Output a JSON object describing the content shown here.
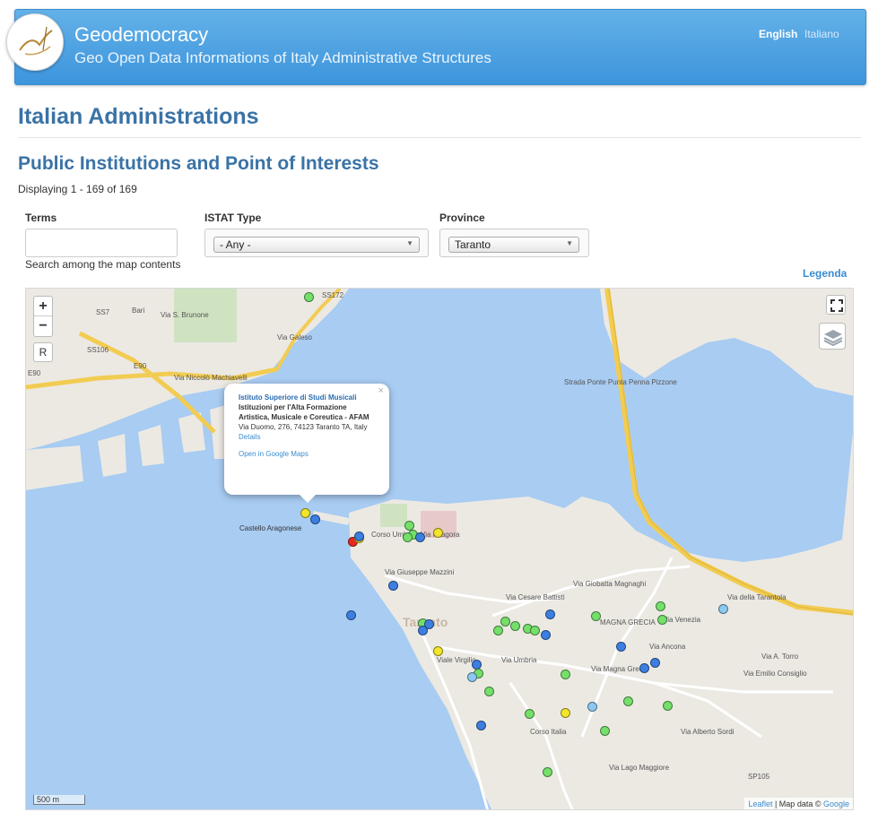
{
  "header": {
    "site_name": "Geodemocracy",
    "slogan": "Geo Open Data Informations of Italy Administrative Structures",
    "languages": [
      "English",
      "Italiano"
    ]
  },
  "page": {
    "title": "Italian Administrations",
    "view_title": "Public Institutions and Point of Interests",
    "summary": "Displaying 1 - 169 of 169"
  },
  "filters": {
    "terms_label": "Terms",
    "terms_value": "",
    "terms_help": "Search among the map contents",
    "type_label": "ISTAT Type",
    "type_value": "- Any -",
    "province_label": "Province",
    "province_value": "Taranto"
  },
  "legenda": "Legenda",
  "map": {
    "zoom_in": "+",
    "zoom_out": "−",
    "reset": "R",
    "scale": "500 m",
    "attribution_leaflet": "Leaflet",
    "attribution_text": " | Map data © ",
    "attribution_google": "Google",
    "city_label": "Taranto",
    "castle_label": "Castello Aragonese",
    "popup": {
      "title": "Istituto Superiore di Studi Musicali",
      "category": "Istituzioni per l'Alta Formazione Artistica, Musicale e Coreutica - AFAM",
      "address": "Via Duomo, 276, 74123 Taranto TA, Italy",
      "details": "Details",
      "google_maps": "Open in Google Maps",
      "close": "×"
    },
    "streets": {
      "via_giuseppe_mazzini": "Via Giuseppe Mazzini",
      "via_cesare_battisti": "Via Cesare Battisti",
      "via_giobatta_magnaghi": "Via Giobatta Magnaghi",
      "via_della_tarantola": "Via della Tarantola",
      "via_umbria": "Via Umbria",
      "viale_virgilio": "Viale Virgilio",
      "corso_italia": "Corso Italia",
      "via_magna_grecia": "Via Magna Grecia",
      "via_alberto_sordi": "Via Alberto Sordi",
      "via_emilio_consiglio": "Via Emilio Consiglio",
      "via_a_torro": "Via A. Torro",
      "via_venezia": "Via Venezia",
      "via_ancona": "Via Ancona",
      "via_lago_maggiore": "Via Lago Maggiore",
      "via_galeso": "Via Galeso",
      "via_niccolo_machiavelli": "Via Niccolò Machiavelli",
      "strada_ponte_punta_penna": "Strada Ponte Punta Penna Pizzone",
      "corso_umberto": "Corso Umberto",
      "via_pitagora": "Via Pitagora",
      "magna_grecia": "MAGNA GRECIA",
      "via_s_brunone": "Via S. Brunone",
      "sp105": "SP105",
      "ss172": "SS172",
      "ss7": "SS7",
      "ss106": "SS106",
      "e90": "E90",
      "bari": "Bari"
    },
    "marker_colors": {
      "blue": "#3d7fe0",
      "green": "#74e06a",
      "yellow": "#f2e52a",
      "red": "#e8281f",
      "lightblue": "#8cc9ef"
    }
  },
  "colors": {
    "banner": "#4aa0e2",
    "title": "#3a73a6",
    "link": "#3a8cd0",
    "water": "#a8ccf2",
    "land": "#ece9e3"
  }
}
